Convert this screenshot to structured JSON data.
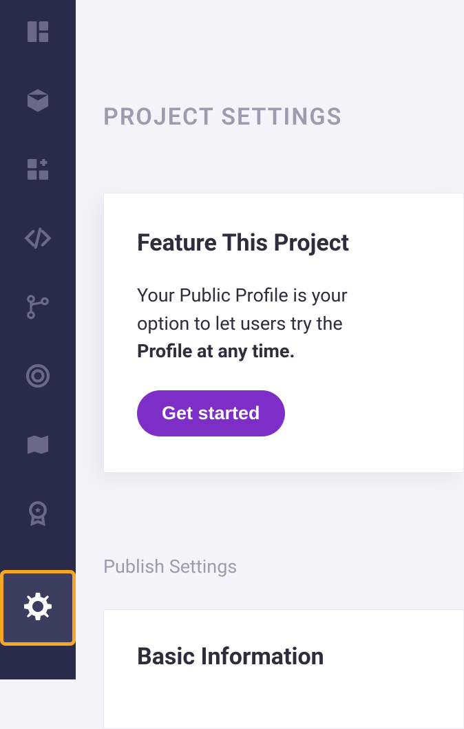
{
  "sidebar": {
    "items": [
      {
        "name": "dashboard-icon"
      },
      {
        "name": "package-icon"
      },
      {
        "name": "add-block-icon"
      },
      {
        "name": "code-icon"
      },
      {
        "name": "branch-icon"
      },
      {
        "name": "target-icon"
      },
      {
        "name": "map-icon"
      },
      {
        "name": "badge-icon"
      },
      {
        "name": "settings-icon"
      }
    ]
  },
  "page": {
    "title": "PROJECT SETTINGS"
  },
  "feature_card": {
    "title": "Feature This Project",
    "text_line1": "Your Public Profile is your",
    "text_line2": "option to let users try the",
    "text_bold": "Profile at any time.",
    "button_label": "Get started"
  },
  "publish_section": {
    "label": "Publish Settings",
    "card_title": "Basic Information"
  }
}
